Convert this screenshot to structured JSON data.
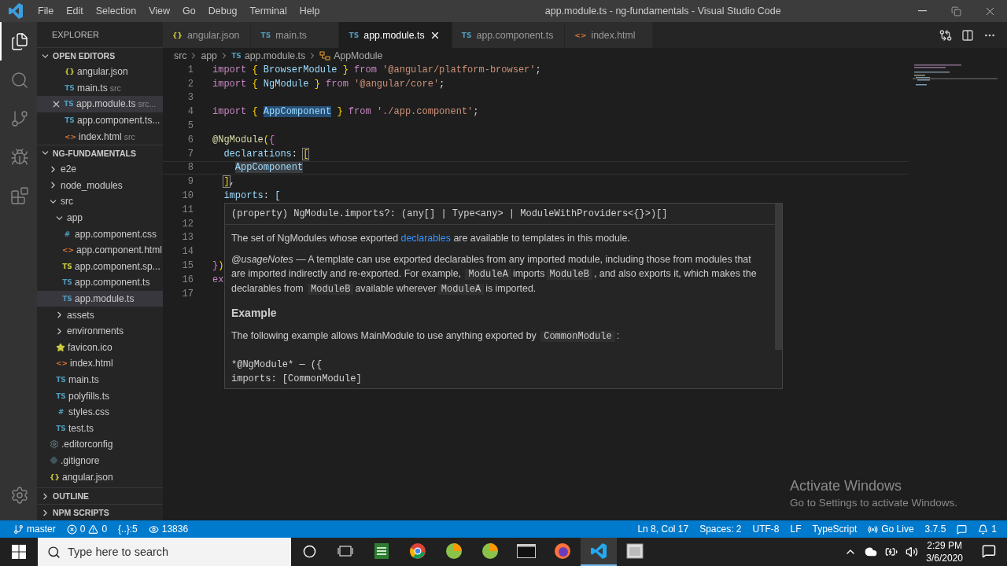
{
  "title_bar": {
    "menu": [
      "File",
      "Edit",
      "Selection",
      "View",
      "Go",
      "Debug",
      "Terminal",
      "Help"
    ],
    "title": "app.module.ts - ng-fundamentals - Visual Studio Code"
  },
  "activity_bar": [
    {
      "kind": "explorer",
      "selected": true
    },
    {
      "kind": "search",
      "selected": false
    },
    {
      "kind": "scm",
      "selected": false
    },
    {
      "kind": "debug",
      "selected": false
    },
    {
      "kind": "extensions",
      "selected": false
    }
  ],
  "sidebar": {
    "title": "EXPLORER",
    "sections": [
      {
        "kind": "editors",
        "title": "OPEN EDITORS",
        "expanded": true,
        "items": [
          {
            "name": "angular.json",
            "kind": "json",
            "icon": "{}",
            "selected": false
          },
          {
            "name": "main.ts",
            "hint": "src",
            "kind": "ts",
            "icon": "TS",
            "selected": false
          },
          {
            "name": "app.module.ts",
            "hint": "src...",
            "kind": "ts",
            "icon": "TS",
            "selected": true
          },
          {
            "name": "app.component.ts...",
            "kind": "ts",
            "icon": "TS",
            "selected": false
          },
          {
            "name": "index.html",
            "hint": "src",
            "kind": "html",
            "icon": "<>",
            "selected": false
          }
        ]
      },
      {
        "kind": "tree",
        "title": "NG-FUNDAMENTALS",
        "expanded": true,
        "items": [
          {
            "name": "e2e",
            "kind": "folder",
            "expanded": false,
            "selected": false
          },
          {
            "name": "node_modules",
            "kind": "folder",
            "expanded": false,
            "selected": false
          },
          {
            "name": "src",
            "kind": "folder",
            "expanded": true,
            "selected": false,
            "children": [
              {
                "name": "app",
                "kind": "folder",
                "expanded": true,
                "selected": false,
                "children": [
                  {
                    "name": "app.component.css",
                    "kind": "css",
                    "icon": "#",
                    "selected": false
                  },
                  {
                    "name": "app.component.html",
                    "kind": "html",
                    "icon": "<>",
                    "selected": false
                  },
                  {
                    "name": "app.component.sp...",
                    "kind": "spec",
                    "icon": "TS",
                    "selected": false
                  },
                  {
                    "name": "app.component.ts",
                    "kind": "ts",
                    "icon": "TS",
                    "selected": false
                  },
                  {
                    "name": "app.module.ts",
                    "kind": "ts",
                    "icon": "TS",
                    "selected": true
                  }
                ]
              },
              {
                "name": "assets",
                "kind": "folder",
                "expanded": false,
                "selected": false
              },
              {
                "name": "environments",
                "kind": "folder",
                "expanded": false,
                "selected": false
              },
              {
                "name": "favicon.ico",
                "kind": "star",
                "selected": false
              },
              {
                "name": "index.html",
                "kind": "html",
                "icon": "<>",
                "selected": false
              },
              {
                "name": "main.ts",
                "kind": "ts",
                "icon": "TS",
                "selected": false
              },
              {
                "name": "polyfills.ts",
                "kind": "ts",
                "icon": "TS",
                "selected": false
              },
              {
                "name": "styles.css",
                "kind": "css",
                "icon": "#",
                "selected": false
              },
              {
                "name": "test.ts",
                "kind": "ts",
                "icon": "TS",
                "selected": false
              }
            ]
          },
          {
            "name": ".editorconfig",
            "kind": "gear",
            "selected": false
          },
          {
            "name": ".gitignore",
            "kind": "diamond",
            "selected": false
          },
          {
            "name": "angular.json",
            "kind": "json",
            "icon": "{}",
            "selected": false
          }
        ]
      },
      {
        "kind": "panel",
        "title": "OUTLINE",
        "expanded": false
      },
      {
        "kind": "panel",
        "title": "NPM SCRIPTS",
        "expanded": false
      }
    ]
  },
  "tabs": [
    {
      "label": "angular.json",
      "kind": "json",
      "icon": "{}",
      "selected": false
    },
    {
      "label": "main.ts",
      "kind": "ts",
      "icon": "TS",
      "selected": false
    },
    {
      "label": "app.module.ts",
      "kind": "ts",
      "icon": "TS",
      "selected": true
    },
    {
      "label": "app.component.ts",
      "kind": "ts",
      "icon": "TS",
      "selected": false
    },
    {
      "label": "index.html",
      "kind": "html",
      "icon": "<>",
      "selected": false
    }
  ],
  "breadcrumb": [
    {
      "label": "src",
      "kind": "folder"
    },
    {
      "label": "app",
      "kind": "folder"
    },
    {
      "label": "app.module.ts",
      "kind": "ts",
      "icon": "TS"
    },
    {
      "label": "AppModule",
      "kind": "symbol"
    }
  ],
  "editor": {
    "lines": [
      {
        "number": "1",
        "current": false,
        "tokens": [
          {
            "text": "import",
            "kind": "keyword"
          },
          {
            "text": " {",
            "kind": "brace"
          },
          {
            "text": " BrowserModule ",
            "kind": "variable"
          },
          {
            "text": "}",
            "kind": "brace"
          },
          {
            "text": " from ",
            "kind": "keyword"
          },
          {
            "text": "'@angular/platform-browser'",
            "kind": "string"
          },
          {
            "text": ";",
            "kind": "plain"
          }
        ]
      },
      {
        "number": "2",
        "current": false,
        "tokens": [
          {
            "text": "import",
            "kind": "keyword"
          },
          {
            "text": " {",
            "kind": "brace"
          },
          {
            "text": " NgModule ",
            "kind": "variable"
          },
          {
            "text": "}",
            "kind": "brace"
          },
          {
            "text": " from ",
            "kind": "keyword"
          },
          {
            "text": "'@angular/core'",
            "kind": "string"
          },
          {
            "text": ";",
            "kind": "plain"
          }
        ]
      },
      {
        "number": "3",
        "current": false
      },
      {
        "number": "4",
        "current": false,
        "tokens": [
          {
            "text": "import",
            "kind": "keyword"
          },
          {
            "text": " {",
            "kind": "brace"
          },
          {
            "text": " AppComponent",
            "kind": "highlight"
          },
          {
            "text": " }",
            "kind": "brace"
          },
          {
            "text": " from ",
            "kind": "keyword"
          },
          {
            "text": "'./app.component'",
            "kind": "string"
          },
          {
            "text": ";",
            "kind": "plain"
          }
        ]
      },
      {
        "number": "5",
        "current": false
      },
      {
        "number": "6",
        "current": false,
        "tokens": [
          {
            "text": "@NgModule",
            "kind": "decorator"
          },
          {
            "text": "(",
            "kind": "brace"
          },
          {
            "text": "{",
            "kind": "paren"
          }
        ]
      },
      {
        "number": "7",
        "current": false,
        "tokens": [
          {
            "text": "  declarations",
            "kind": "variable"
          },
          {
            "text": ": ",
            "kind": "plain"
          },
          {
            "text": "[",
            "kind": "match"
          }
        ]
      },
      {
        "number": "8",
        "current": true,
        "tokens": [
          {
            "text": "    AppComponent",
            "kind": "selection"
          }
        ]
      },
      {
        "number": "9",
        "current": false,
        "tokens": [
          {
            "text": "  ]",
            "kind": "match"
          },
          {
            "text": ",",
            "kind": "plain"
          }
        ]
      },
      {
        "number": "10",
        "current": false,
        "tokens": [
          {
            "text": "  imports",
            "kind": "variable"
          },
          {
            "text": ": ",
            "kind": "plain"
          },
          {
            "text": "[",
            "kind": "variable"
          }
        ]
      },
      {
        "number": "11",
        "current": false
      },
      {
        "number": "12",
        "current": false
      },
      {
        "number": "13",
        "current": false
      },
      {
        "number": "14",
        "current": false
      },
      {
        "number": "15",
        "current": false,
        "tokens": [
          {
            "text": "}",
            "kind": "paren"
          },
          {
            "text": ")",
            "kind": "brace"
          }
        ]
      },
      {
        "number": "16",
        "current": false,
        "tokens": [
          {
            "text": "ex",
            "kind": "keyword"
          }
        ]
      },
      {
        "number": "17",
        "current": false
      }
    ]
  },
  "hover": {
    "signature": "(property) NgModule.imports?: (any[] | Type<any> | ModuleWithProviders<{}>)[]",
    "paragraphs": [
      [
        {
          "text": "The set of NgModules whose exported ",
          "kind": "text"
        },
        {
          "text": "declarables",
          "kind": "link"
        },
        {
          "text": " are available to templates in this module.",
          "kind": "text"
        }
      ],
      [
        {
          "text": "@usageNotes",
          "kind": "italic"
        },
        {
          "text": " — A template can use exported declarables from any imported module, including those from modules that are imported indirectly and re-exported. For example, ",
          "kind": "text"
        },
        {
          "text": "ModuleA",
          "kind": "code"
        },
        {
          "text": "imports",
          "kind": "text"
        },
        {
          "text": "ModuleB",
          "kind": "code"
        },
        {
          "text": ", and also exports it, which makes the declarables from ",
          "kind": "text"
        },
        {
          "text": "ModuleB",
          "kind": "code"
        },
        {
          "text": "available wherever",
          "kind": "text"
        },
        {
          "text": "ModuleA",
          "kind": "code"
        },
        {
          "text": "is imported.",
          "kind": "text"
        }
      ]
    ],
    "heading": "Example",
    "example": [
      {
        "text": "The following example allows MainModule to use anything exported by ",
        "kind": "text"
      },
      {
        "text": "CommonModule",
        "kind": "code"
      },
      {
        "text": ":",
        "kind": "text"
      }
    ],
    "code": [
      "*@NgModule* — ({",
      "imports: [CommonModule]"
    ]
  },
  "activation": {
    "title": "Activate Windows",
    "subtitle": "Go to Settings to activate Windows."
  },
  "status_bar": {
    "left": [
      {
        "kind": "branch",
        "text": "master"
      },
      {
        "kind": "problems",
        "errors": "0",
        "warnings": "0"
      },
      {
        "kind": "plain",
        "text": "{..}:5"
      },
      {
        "kind": "watch",
        "text": "13836"
      }
    ],
    "right": [
      {
        "kind": "plain",
        "text": "Ln 8, Col 17"
      },
      {
        "kind": "plain",
        "text": "Spaces: 2"
      },
      {
        "kind": "plain",
        "text": "UTF-8"
      },
      {
        "kind": "plain",
        "text": "LF"
      },
      {
        "kind": "plain",
        "text": "TypeScript"
      },
      {
        "kind": "live",
        "text": "Go Live"
      },
      {
        "kind": "plain",
        "text": "3.7.5"
      },
      {
        "kind": "feedback"
      },
      {
        "kind": "bell",
        "text": "1"
      }
    ]
  },
  "taskbar": {
    "search": {
      "placeholder": "Type here to search"
    },
    "apps": [
      {
        "kind": "sheet",
        "selected": false
      },
      {
        "kind": "chrome",
        "selected": false
      },
      {
        "kind": "lime",
        "selected": false
      },
      {
        "kind": "lime",
        "selected": false
      },
      {
        "kind": "terminal",
        "selected": false
      },
      {
        "kind": "firefox",
        "selected": false
      },
      {
        "kind": "vscode",
        "selected": true
      },
      {
        "kind": "window",
        "selected": false
      }
    ],
    "time": "2:29 PM",
    "date": "3/6/2020"
  }
}
